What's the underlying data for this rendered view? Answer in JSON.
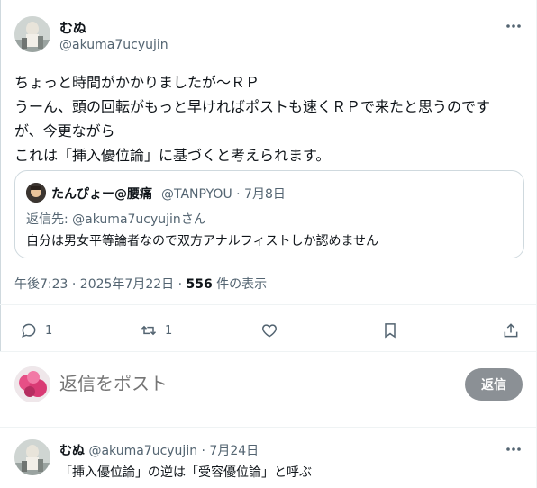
{
  "tweet": {
    "author_name": "むぬ",
    "author_handle": "@akuma7ucyujin",
    "lines": [
      "ちょっと時間がかかりましたが～ＲＰ",
      "うーん、頭の回転がもっと早ければポストも速くＲＰで来たと思うのです",
      "が、今更ながら",
      "これは「挿入優位論」に基づくと考えられます。"
    ],
    "meta_prefix": "午後7:23 · 2025年7月22日 · ",
    "views_count": "556",
    "views_suffix": " 件の表示"
  },
  "quote": {
    "name": "たんぴょー@腰痛",
    "handle_date": "@TANPYOU · 7月8日",
    "reply_to_prefix": "返信先: ",
    "reply_to_mention": "@akuma7ucyujin",
    "reply_to_suffix": "さん",
    "body": "自分は男女平等論者なので双方アナルフィストしか認めません"
  },
  "actions": {
    "reply_count": "1",
    "retweet_count": "1"
  },
  "composer": {
    "placeholder": "返信をポスト",
    "button_label": "返信"
  },
  "reply": {
    "name": "むぬ",
    "handle_date": " @akuma7ucyujin · 7月24日",
    "body": "「挿入優位論」の逆は「受容優位論」と呼ぶ"
  },
  "icons": {
    "more": "more-dots-icon",
    "reply": "speech-bubble-icon",
    "retweet": "retweet-arrows-icon",
    "like": "heart-icon",
    "bookmark": "bookmark-icon",
    "share": "share-upload-icon"
  },
  "colors": {
    "text": "#0f1419",
    "secondary": "#536471",
    "border": "#cfd9de",
    "reply_button": "#8b9095"
  }
}
